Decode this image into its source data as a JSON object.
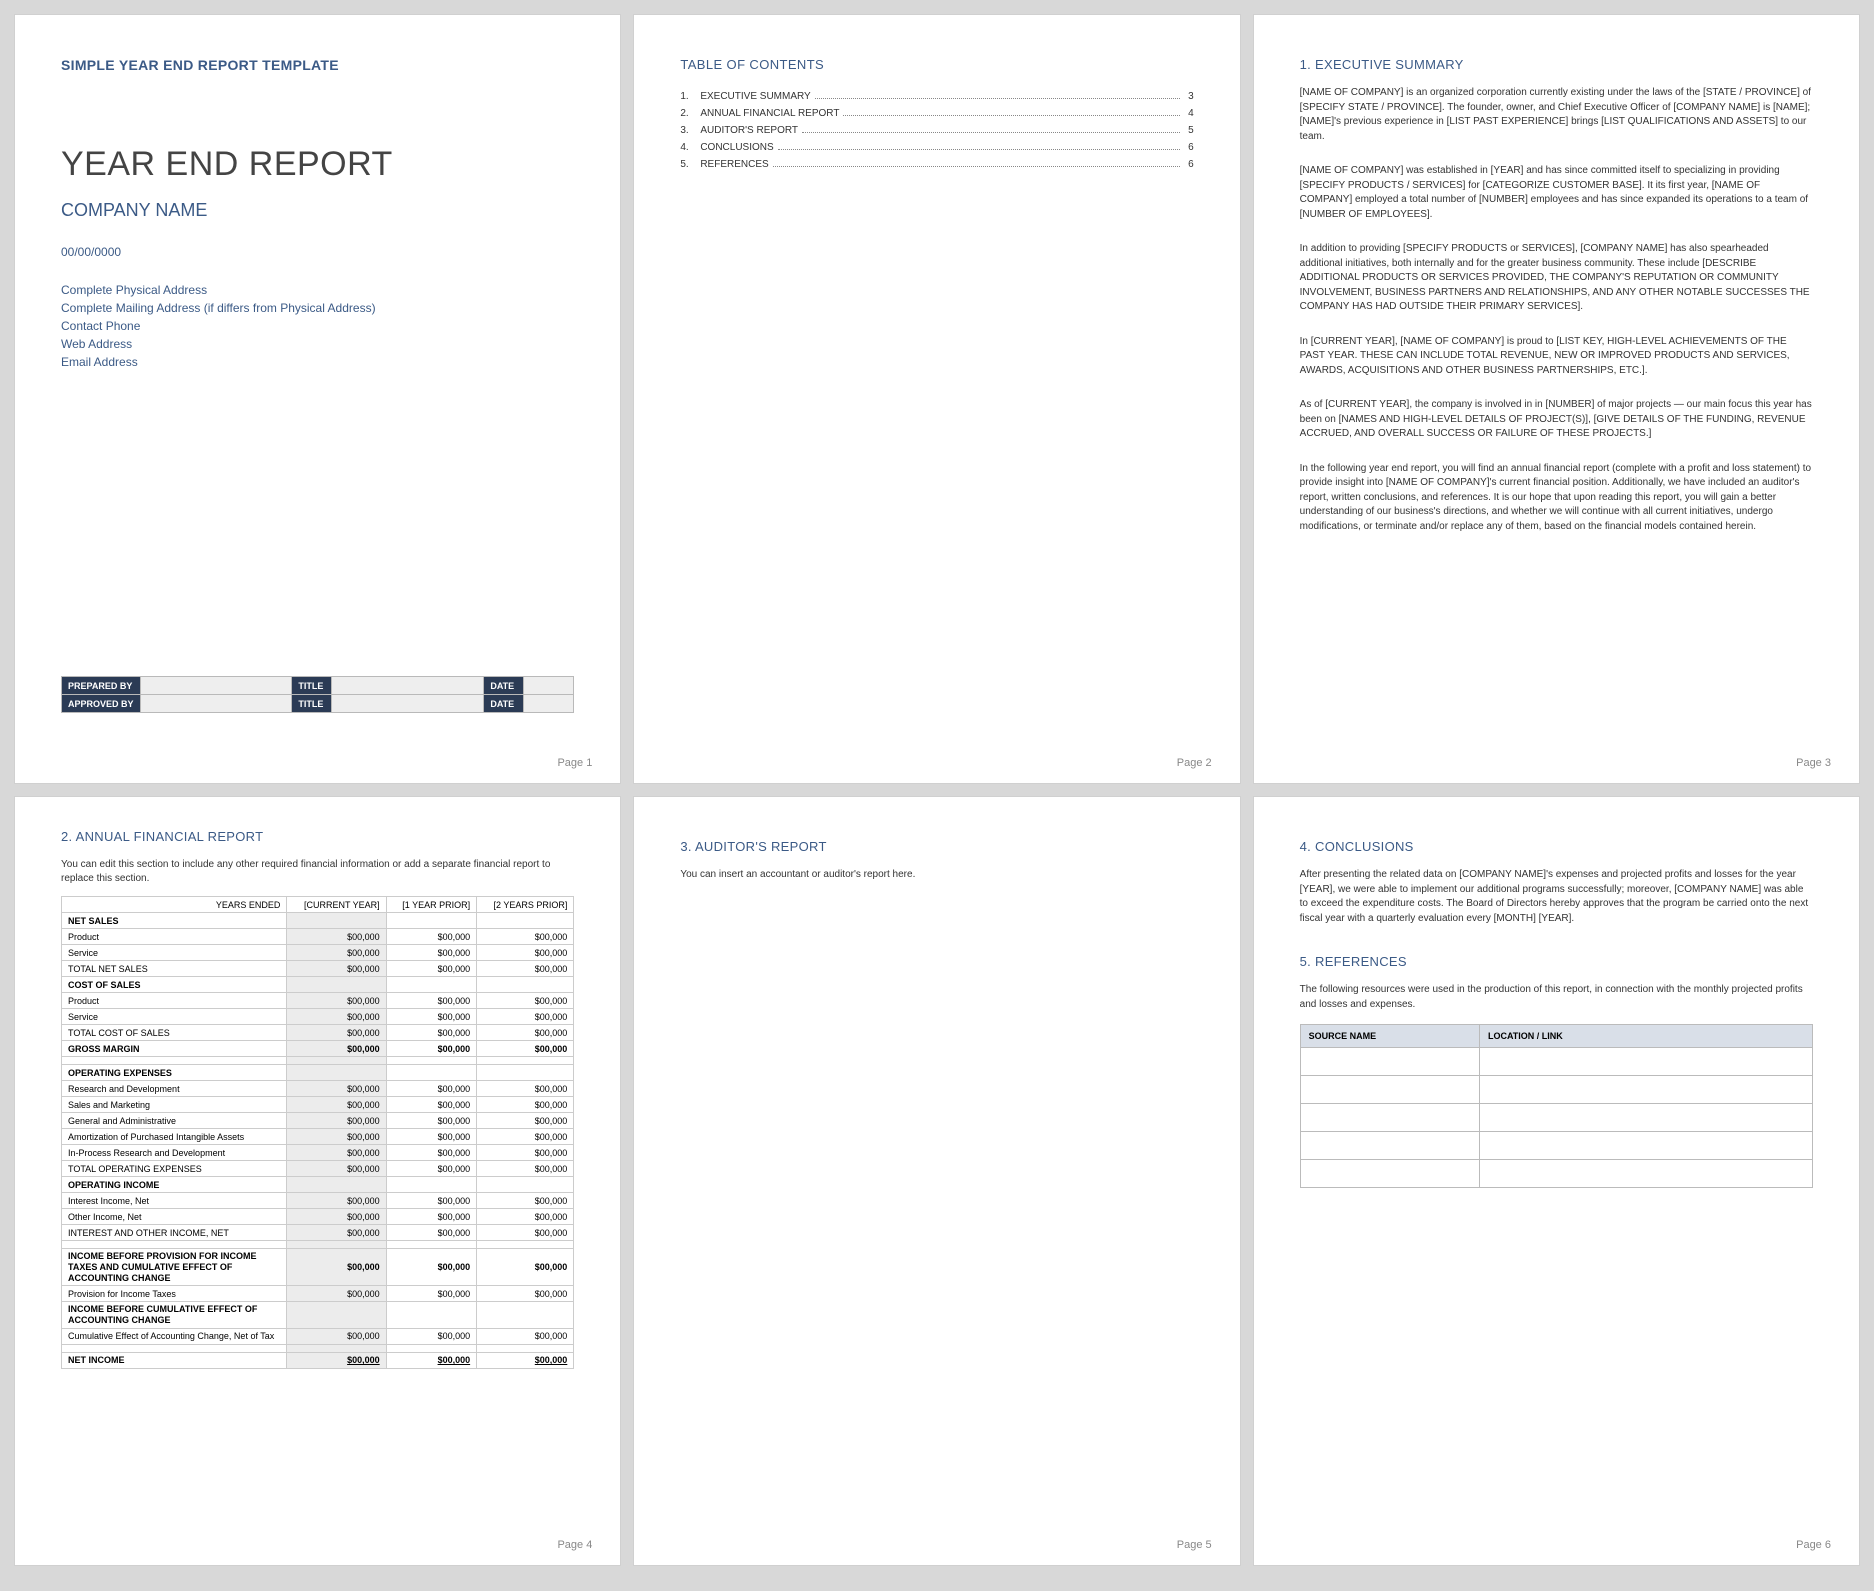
{
  "template_title": "SIMPLE YEAR END REPORT TEMPLATE",
  "main_title": "YEAR END REPORT",
  "company_name": "COMPANY NAME",
  "date_line": "00/00/0000",
  "address": {
    "physical": "Complete Physical Address",
    "mailing": "Complete Mailing Address (if differs from Physical Address)",
    "phone": "Contact Phone",
    "web": "Web Address",
    "email": "Email Address"
  },
  "sign": {
    "prepared_by": "PREPARED BY",
    "approved_by": "APPROVED BY",
    "title": "TITLE",
    "date": "DATE"
  },
  "toc_title": "TABLE OF CONTENTS",
  "toc": [
    {
      "n": "1.",
      "label": "EXECUTIVE SUMMARY",
      "pg": "3"
    },
    {
      "n": "2.",
      "label": "ANNUAL FINANCIAL REPORT",
      "pg": "4"
    },
    {
      "n": "3.",
      "label": "AUDITOR'S REPORT",
      "pg": "5"
    },
    {
      "n": "4.",
      "label": "CONCLUSIONS",
      "pg": "6"
    },
    {
      "n": "5.",
      "label": "REFERENCES",
      "pg": "6"
    }
  ],
  "exec": {
    "title": "1.  EXECUTIVE SUMMARY",
    "p1": "[NAME OF COMPANY] is an organized corporation currently existing under the laws of the [STATE / PROVINCE] of [SPECIFY STATE / PROVINCE]. The founder, owner, and Chief Executive Officer of [COMPANY NAME] is [NAME]; [NAME]'s previous experience in [LIST PAST EXPERIENCE] brings [LIST QUALIFICATIONS AND ASSETS] to our team.",
    "p2": "[NAME OF COMPANY] was established in [YEAR] and has since committed itself to specializing in providing [SPECIFY PRODUCTS / SERVICES] for [CATEGORIZE CUSTOMER BASE]. It its first year, [NAME OF COMPANY] employed a total number of [NUMBER] employees and has since expanded its operations to a team of [NUMBER OF EMPLOYEES].",
    "p3": "In addition to providing [SPECIFY PRODUCTS or SERVICES], [COMPANY NAME] has also spearheaded additional initiatives, both internally and for the greater business community. These include [DESCRIBE ADDITIONAL PRODUCTS OR SERVICES PROVIDED, THE COMPANY'S REPUTATION OR COMMUNITY INVOLVEMENT, BUSINESS PARTNERS AND RELATIONSHIPS, AND ANY OTHER NOTABLE SUCCESSES THE COMPANY HAS HAD OUTSIDE THEIR PRIMARY SERVICES].",
    "p4": "In [CURRENT YEAR], [NAME OF COMPANY] is proud to [LIST KEY, HIGH-LEVEL ACHIEVEMENTS OF THE PAST YEAR. THESE CAN INCLUDE TOTAL REVENUE, NEW OR IMPROVED PRODUCTS AND SERVICES, AWARDS, ACQUISITIONS AND OTHER BUSINESS PARTNERSHIPS, ETC.].",
    "p5": "As of [CURRENT YEAR], the company is involved in in [NUMBER] of major projects — our main focus this year has been on [NAMES AND HIGH-LEVEL DETAILS OF PROJECT(S)], [GIVE DETAILS OF THE FUNDING, REVENUE ACCRUED, AND OVERALL SUCCESS OR FAILURE OF THESE PROJECTS.]",
    "p6": "In the following year end report, you will find an annual financial report (complete with a profit and loss statement) to provide insight into [NAME OF COMPANY]'s current financial position. Additionally, we have included an auditor's report, written conclusions, and references. It is our hope that upon reading this report, you will gain a better understanding of our business's directions, and whether we will continue with all current initiatives, undergo modifications, or terminate and/or replace any of them, based on the financial models contained herein."
  },
  "fin": {
    "title": "2.  ANNUAL FINANCIAL REPORT",
    "intro": "You can edit this section to include any other required financial information or add a separate financial report to replace this section.",
    "headers": {
      "ye": "YEARS ENDED",
      "c0": "[CURRENT YEAR]",
      "c1": "[1 YEAR PRIOR]",
      "c2": "[2 YEARS PRIOR]"
    },
    "rows": {
      "net_sales": "NET SALES",
      "product": "Product",
      "service": "Service",
      "total_net_sales": "TOTAL NET SALES",
      "cost_of_sales": "COST OF SALES",
      "total_cost_of_sales": "TOTAL COST OF SALES",
      "gross_margin": "GROSS MARGIN",
      "operating_expenses": "OPERATING EXPENSES",
      "rnd": "Research and Development",
      "sales_marketing": "Sales and Marketing",
      "ga": "General and Administrative",
      "amort": "Amortization of Purchased Intangible Assets",
      "inprocess": "In-Process Research and Development",
      "total_opex": "TOTAL OPERATING EXPENSES",
      "operating_income": "OPERATING INCOME",
      "interest_income": "Interest Income, Net",
      "other_income": "Other Income, Net",
      "interest_other": "INTEREST AND OTHER INCOME, NET",
      "income_before_prov": "INCOME BEFORE PROVISION FOR INCOME TAXES AND CUMULATIVE EFFECT OF ACCOUNTING CHANGE",
      "provision": "Provision for Income Taxes",
      "income_before_cum": "INCOME BEFORE CUMULATIVE EFFECT OF ACCOUNTING CHANGE",
      "cum_effect": "Cumulative Effect of Accounting Change, Net of Tax",
      "net_income": "NET INCOME"
    },
    "amt": "$00,000"
  },
  "auditor": {
    "title": "3.  AUDITOR'S REPORT",
    "intro": "You can insert an accountant or auditor's report here."
  },
  "conclusions": {
    "title": "4.  CONCLUSIONS",
    "text": "After presenting the related data on [COMPANY NAME]'s expenses and projected profits and losses for the year [YEAR], we were able to implement our additional programs successfully; moreover, [COMPANY NAME] was able to exceed the expenditure costs. The Board of Directors hereby approves that the program be carried onto the next fiscal year with a quarterly evaluation every [MONTH] [YEAR]."
  },
  "references": {
    "title": "5.  REFERENCES",
    "intro": "The following resources were used in the production of this report, in connection with the monthly projected profits and losses and expenses.",
    "col1": "SOURCE NAME",
    "col2": "LOCATION / LINK"
  },
  "pages": {
    "p1": "Page 1",
    "p2": "Page 2",
    "p3": "Page 3",
    "p4": "Page 4",
    "p5": "Page 5",
    "p6": "Page 6"
  }
}
